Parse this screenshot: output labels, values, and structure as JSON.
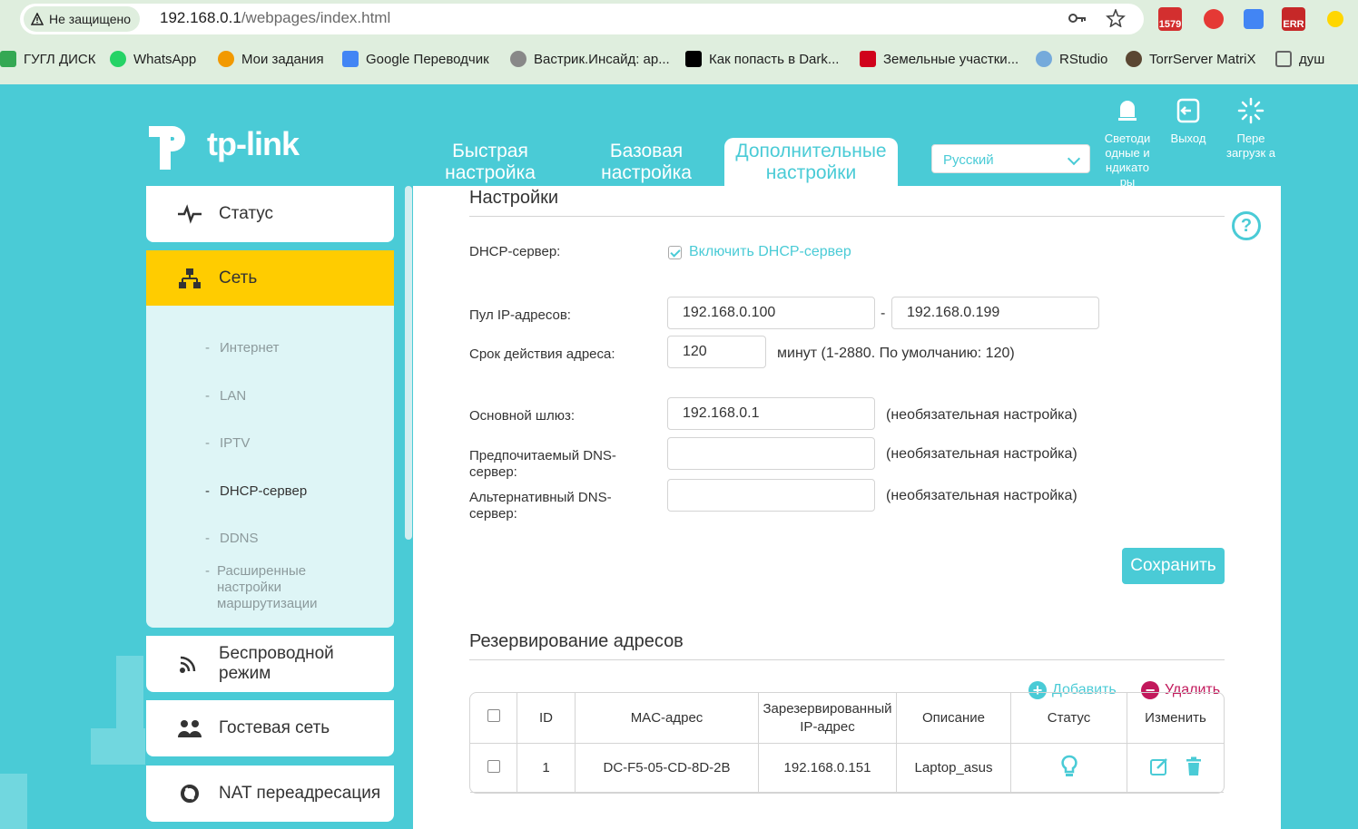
{
  "browser": {
    "security_label": "Не защищено",
    "url_host": "192.168.0.1",
    "url_path": "/webpages/index.html",
    "ext_badges": [
      "1579",
      "ERR"
    ]
  },
  "bookmarks": [
    {
      "label": "ГУГЛ ДИСК",
      "color": "#34a853"
    },
    {
      "label": "WhatsApp",
      "color": "#25d366"
    },
    {
      "label": "Мои задания",
      "color": "#f29900"
    },
    {
      "label": "Google Переводчик",
      "color": "#4285f4"
    },
    {
      "label": "Вастрик.Инсайд: ар...",
      "color": "#888888"
    },
    {
      "label": "Как попасть в Dark...",
      "color": "#000000"
    },
    {
      "label": "Земельные участки...",
      "color": "#d0021b"
    },
    {
      "label": "RStudio",
      "color": "#75aadb"
    },
    {
      "label": "TorrServer MatriX",
      "color": "#5a4632"
    },
    {
      "label": "душ",
      "color": "#666666"
    }
  ],
  "router": {
    "logo": "tp-link",
    "nav": {
      "quick": "Быстрая настройка",
      "basic": "Базовая настройка",
      "advanced": "Дополнительные настройки"
    },
    "language": "Русский",
    "actions": {
      "led": "Светоди одные и ндикато ры",
      "logout": "Выход",
      "reboot": "Пере загрузк а"
    }
  },
  "sidebar": {
    "status": "Статус",
    "network": "Сеть",
    "sub": [
      "Интернет",
      "LAN",
      "IPTV",
      "DHCP-сервер",
      "DDNS",
      "Расширенные настройки маршрутизации"
    ],
    "wireless": "Беспроводной режим",
    "guest": "Гостевая сеть",
    "nat": "NAT переадресация"
  },
  "settings": {
    "title": "Настройки",
    "dhcp_label": "DHCP-сервер:",
    "dhcp_checkbox": "Включить DHCP-сервер",
    "pool_label": "Пул IP-адресов:",
    "pool_start": "192.168.0.100",
    "pool_sep": "-",
    "pool_end": "192.168.0.199",
    "lease_label": "Срок действия адреса:",
    "lease_value": "120",
    "lease_hint": "минут (1-2880. По умолчанию: 120)",
    "gateway_label": "Основной шлюз:",
    "gateway_value": "192.168.0.1",
    "optional_hint": "(необязательная настройка)",
    "dns1_label": "Предпочитаемый DNS-сервер:",
    "dns1_value": "",
    "dns2_label": "Альтернативный DNS-сервер:",
    "dns2_value": "",
    "save": "Сохранить"
  },
  "reservation": {
    "title": "Резервирование адресов",
    "add": "Добавить",
    "delete": "Удалить",
    "columns": [
      "ID",
      "MAC-адрес",
      "Зарезервированный IP-адрес",
      "Описание",
      "Статус",
      "Изменить"
    ],
    "rows": [
      {
        "id": "1",
        "mac": "DC-F5-05-CD-8D-2B",
        "ip": "192.168.0.151",
        "desc": "Laptop_asus"
      }
    ]
  },
  "colors": {
    "accent": "#4acbd6",
    "active_menu": "#ffcc00",
    "delete": "#c2185b"
  }
}
